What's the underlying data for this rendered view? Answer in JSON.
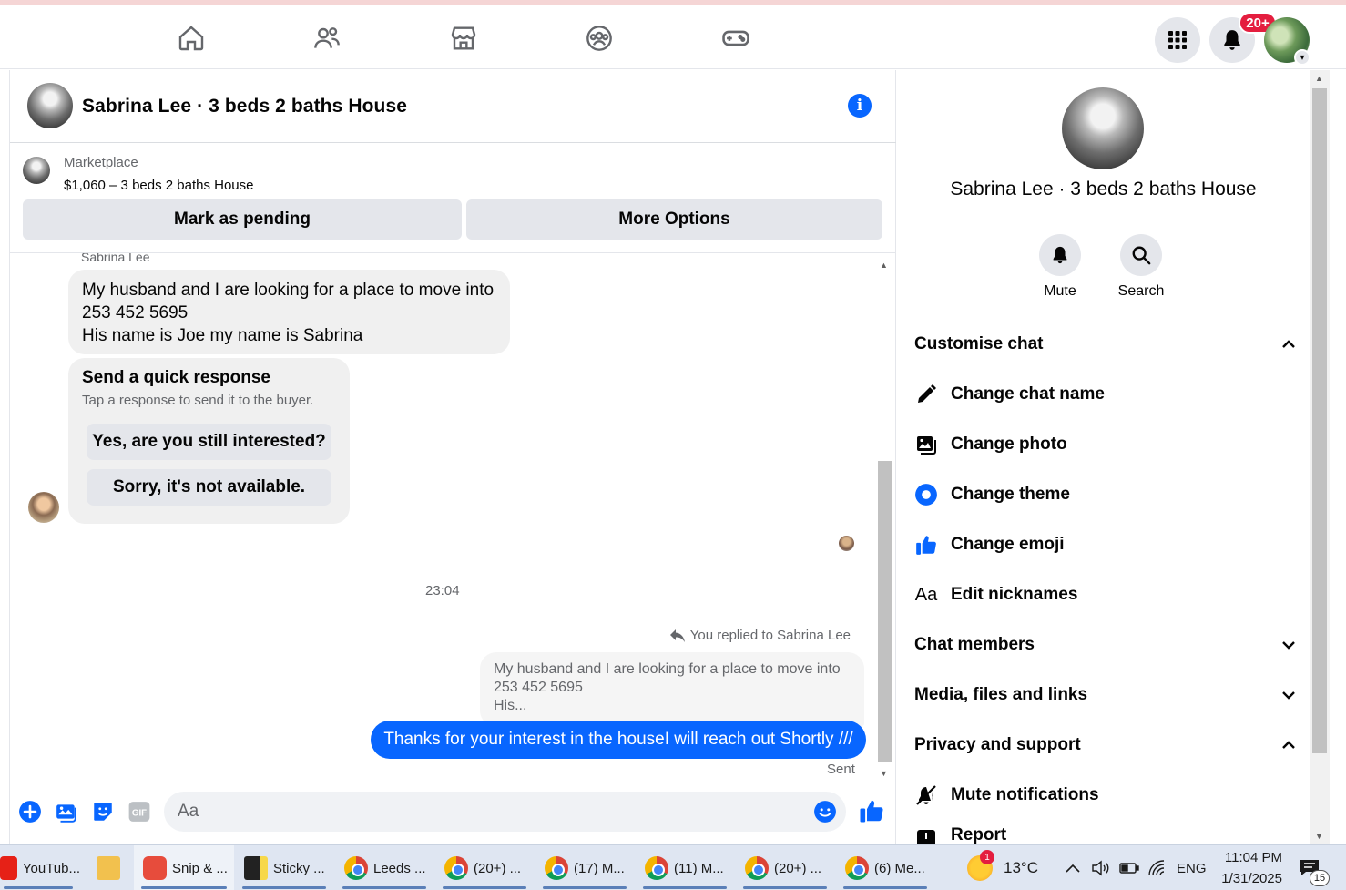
{
  "header": {
    "chat_title": "Sabrina Lee · 3 beds 2 baths House",
    "notifications_badge": "20+"
  },
  "marketplace": {
    "label": "Marketplace",
    "listing": "$1,060 – 3 beds 2 baths House",
    "mark_pending": "Mark as pending",
    "more_options": "More Options"
  },
  "messages": {
    "sender_name": "Sabrina Lee",
    "incoming_lines": [
      "My husband and I are looking for a place to move into",
      "253 452 5695",
      "His name is Joe my name is Sabrina"
    ],
    "quick_title": "Send a quick response",
    "quick_subtitle": "Tap a response to send it to the buyer.",
    "quick_options": [
      "Yes, are you still interested?",
      "Sorry, it's not available."
    ],
    "timestamp": "23:04",
    "replied_to": "You replied to Sabrina Lee",
    "quoted_lines": [
      "My husband and I are looking for a place to move into",
      "253 452 5695",
      "His..."
    ],
    "outgoing": "Thanks for your interest in the houseI will reach out Shortly ///",
    "status": "Sent"
  },
  "composer": {
    "placeholder": "Aa"
  },
  "info_panel": {
    "title": "Sabrina Lee · 3 beds 2 baths House",
    "actions": [
      "Mute",
      "Search"
    ],
    "sections": {
      "customise": "Customise chat",
      "members": "Chat members",
      "media": "Media, files and links",
      "privacy": "Privacy and support"
    },
    "customise_options": [
      "Change chat name",
      "Change photo",
      "Change theme",
      "Change emoji",
      "Edit nicknames"
    ],
    "privacy_options": [
      "Mute notifications",
      "Report"
    ]
  },
  "taskbar": {
    "items": [
      "YouTub...",
      "Snip & ...",
      "Sticky ...",
      "Leeds ...",
      "(20+) ...",
      "(17) M...",
      "(11) M...",
      "(20+) ...",
      "(6) Me..."
    ],
    "weather": "13°C",
    "weather_badge": "1",
    "language": "ENG",
    "time": "11:04 PM",
    "date": "1/31/2025",
    "notification_count": "15"
  },
  "colors": {
    "accent": "#0866ff",
    "bubble_gray": "#f0f0f0",
    "button_gray": "#e4e6eb",
    "badge_red": "#e41e3f"
  }
}
